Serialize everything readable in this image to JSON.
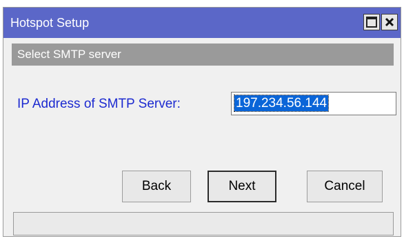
{
  "window": {
    "title": "Hotspot Setup"
  },
  "section": {
    "heading": "Select SMTP server"
  },
  "form": {
    "ip_label": "IP Address of SMTP Server:",
    "ip_value": "197.234.56.144"
  },
  "buttons": {
    "back": "Back",
    "next": "Next",
    "cancel": "Cancel"
  },
  "icons": {
    "maximize": "maximize-icon",
    "close": "close-icon"
  },
  "colors": {
    "titlebar": "#5b67c8",
    "label": "#1c2ad0",
    "selection": "#0a65d8"
  }
}
